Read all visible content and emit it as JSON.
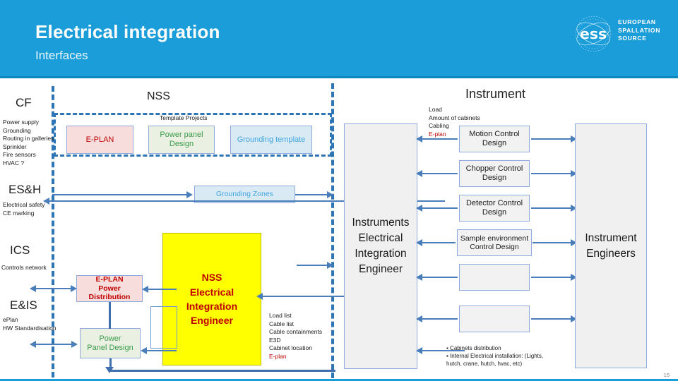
{
  "header": {
    "title": "Electrical integration",
    "subtitle": "Interfaces",
    "logo_name": "ess",
    "logo_line1": "EUROPEAN",
    "logo_line2": "SPALLATION",
    "logo_line3": "SOURCE",
    "brand_color": "#1b9dd9"
  },
  "groups": {
    "cf": {
      "label": "CF",
      "items": "Power supply\nGrounding\nRouting in galleries\nSprinkler\nFire sensors\nHVAC ?"
    },
    "esh": {
      "label": "ES&H",
      "items": "Electrical safety\nCE marking"
    },
    "ics": {
      "label": "ICS",
      "items": "Controls network"
    },
    "eis": {
      "label": "E&IS",
      "items": "ePlan\nHW Standardisation"
    },
    "nss": {
      "label": "NSS"
    },
    "instrument": {
      "label": "Instrument"
    }
  },
  "template_projects": {
    "caption": "Template Projects",
    "boxes": [
      {
        "label": "E-PLAN"
      },
      {
        "label": "Power panel\nDesign"
      },
      {
        "label": "Grounding template"
      }
    ]
  },
  "grounding_zones": {
    "label": "Grounding Zones"
  },
  "nss_left_boxes": [
    {
      "label": "E-PLAN\nPower Distribution"
    },
    {
      "label": "Power\nPanel Design"
    }
  ],
  "nss_engineer": {
    "label": "NSS\nElectrical\nIntegration\nEngineer"
  },
  "nss_outputs": {
    "items": "Load list\nCable list\nCable containments\nE3D\nCabinet location",
    "red_item": "E-plan"
  },
  "instrument_inputs": {
    "items": "Load\nAmount of cabinets\nCabling",
    "red_item": "E-plan"
  },
  "instrument_engineer": {
    "label": "Instruments\nElectrical\nIntegration\nEngineer"
  },
  "design_boxes": [
    {
      "label": "Motion Control\nDesign"
    },
    {
      "label": "Chopper Control\nDesign"
    },
    {
      "label": "Detector Control\nDesign"
    },
    {
      "label": "Sample environment\nControl Design"
    },
    {
      "label": ""
    },
    {
      "label": ""
    }
  ],
  "instrument_engineers": {
    "label": "Instrument\nEngineers"
  },
  "bullets": {
    "line1": "▪  Cabinets distribution",
    "line2": "▪  Internal Electrical installation: (Lights,",
    "line3": "hutch, crane, hutch, hvac, etc)"
  },
  "page_number": "15"
}
